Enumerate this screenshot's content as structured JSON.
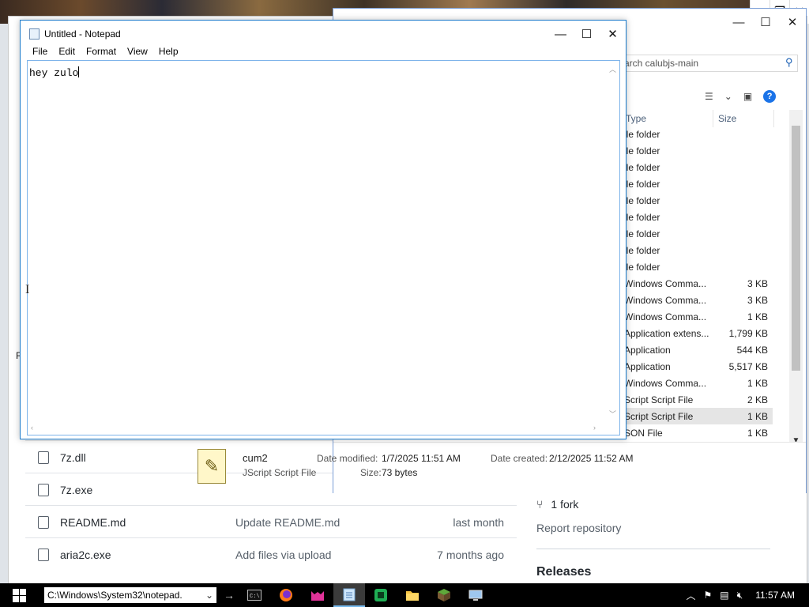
{
  "explorer": {
    "search_placeholder": "arch calubjs-main",
    "column_type": "Type",
    "column_size": "Size",
    "rows": [
      {
        "type": "ile folder",
        "size": ""
      },
      {
        "type": "ile folder",
        "size": ""
      },
      {
        "type": "ile folder",
        "size": ""
      },
      {
        "type": "ile folder",
        "size": ""
      },
      {
        "type": "ile folder",
        "size": ""
      },
      {
        "type": "ile folder",
        "size": ""
      },
      {
        "type": "ile folder",
        "size": ""
      },
      {
        "type": "ile folder",
        "size": ""
      },
      {
        "type": "ile folder",
        "size": ""
      },
      {
        "type": "Windows Comma...",
        "size": "3 KB"
      },
      {
        "type": "Windows Comma...",
        "size": "3 KB"
      },
      {
        "type": "Windows Comma...",
        "size": "1 KB"
      },
      {
        "type": "Application extens...",
        "size": "1,799 KB"
      },
      {
        "type": "Application",
        "size": "544 KB"
      },
      {
        "type": "Application",
        "size": "5,517 KB"
      },
      {
        "type": "Windows Comma...",
        "size": "1 KB"
      },
      {
        "type": "Script Script File",
        "size": "2 KB"
      },
      {
        "type": "Script Script File",
        "size": "1 KB"
      },
      {
        "type": "SON File",
        "size": "1 KB"
      }
    ],
    "details": {
      "name": "cum2",
      "type": "JScript Script File",
      "date_modified_label": "Date modified:",
      "date_modified": "1/7/2025 11:51 AM",
      "date_created_label": "Date created:",
      "date_created": "2/12/2025 11:52 AM",
      "size_label": "Size:",
      "size": "73 bytes"
    }
  },
  "notepad": {
    "title": "Untitled - Notepad",
    "menu": [
      "File",
      "Edit",
      "Format",
      "View",
      "Help"
    ],
    "content": "hey zulo"
  },
  "github": {
    "files": [
      {
        "name": "7z.dll",
        "commit": "",
        "time": ""
      },
      {
        "name": "7z.exe",
        "commit": "",
        "time": ""
      },
      {
        "name": "README.md",
        "commit": "Update README.md",
        "time": "last month"
      },
      {
        "name": "aria2c.exe",
        "commit": "Add files via upload",
        "time": "7 months ago"
      }
    ],
    "forks": "1 fork",
    "report": "Report repository",
    "releases": "Releases"
  },
  "left_fragment": "R",
  "taskbar": {
    "address_value": "C:\\Windows\\System32\\notepad.",
    "clock": "11:57 AM"
  }
}
